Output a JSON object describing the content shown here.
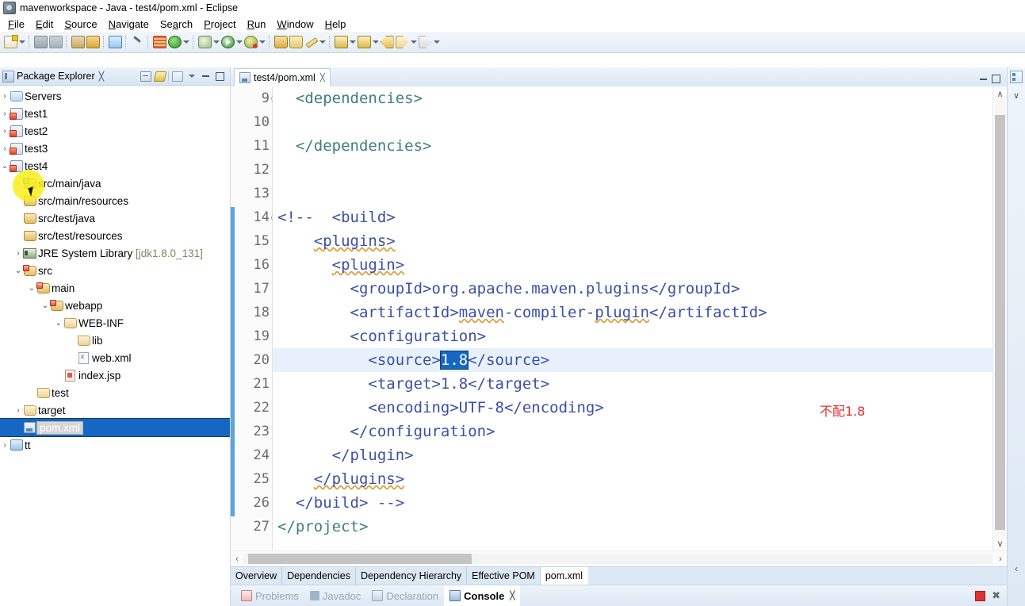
{
  "window": {
    "title": "mavenworkspace - Java - test4/pom.xml - Eclipse"
  },
  "menu": {
    "items": [
      "File",
      "Edit",
      "Source",
      "Navigate",
      "Search",
      "Project",
      "Run",
      "Window",
      "Help"
    ]
  },
  "toolbar": {
    "icons": [
      "new-wizard-icon",
      "save-icon",
      "save-all-icon",
      "print-icon",
      "undo-icon",
      "toggle-breadcrumb-icon",
      "pen-icon",
      "grid-icon",
      "refresh-icon",
      "external-tools-icon",
      "run-icon",
      "debug-icon",
      "open-type-icon",
      "open-resource-icon",
      "search-icon",
      "previous-annotation-icon",
      "next-annotation-icon",
      "back-icon",
      "forward-icon",
      "arrow-icon"
    ]
  },
  "package_explorer": {
    "title": "Package Explorer",
    "close_glyph": "╳",
    "tree": [
      {
        "label": "Servers",
        "indent": 0,
        "arrow": "›",
        "icon": "folder-servers-icon",
        "state": "collapsed"
      },
      {
        "label": "test1",
        "indent": 0,
        "arrow": "›",
        "icon": "maven-project-icon",
        "state": "collapsed"
      },
      {
        "label": "test2",
        "indent": 0,
        "arrow": "›",
        "icon": "maven-project-icon",
        "state": "collapsed"
      },
      {
        "label": "test3",
        "indent": 0,
        "arrow": "›",
        "icon": "maven-project-icon",
        "state": "collapsed"
      },
      {
        "label": "test4",
        "indent": 0,
        "arrow": "⌄",
        "icon": "maven-project-icon",
        "state": "expanded",
        "highlight": true
      },
      {
        "label": "src/main/java",
        "indent": 1,
        "arrow": "›",
        "icon": "source-folder-icon",
        "state": "collapsed"
      },
      {
        "label": "src/main/resources",
        "indent": 1,
        "arrow": "",
        "icon": "package-folder-icon",
        "state": "leaf"
      },
      {
        "label": "src/test/java",
        "indent": 1,
        "arrow": "",
        "icon": "package-folder-icon",
        "state": "leaf"
      },
      {
        "label": "src/test/resources",
        "indent": 1,
        "arrow": "",
        "icon": "package-folder-icon",
        "state": "leaf"
      },
      {
        "label": "JRE System Library",
        "suffix": "[jdk1.8.0_131]",
        "indent": 1,
        "arrow": "›",
        "icon": "jre-library-icon",
        "state": "collapsed"
      },
      {
        "label": "src",
        "indent": 1,
        "arrow": "⌄",
        "icon": "source-root-icon",
        "state": "expanded"
      },
      {
        "label": "main",
        "indent": 2,
        "arrow": "⌄",
        "icon": "source-root-icon",
        "state": "expanded"
      },
      {
        "label": "webapp",
        "indent": 3,
        "arrow": "⌄",
        "icon": "source-root-icon",
        "state": "expanded"
      },
      {
        "label": "WEB-INF",
        "indent": 4,
        "arrow": "⌄",
        "icon": "folder-icon",
        "state": "expanded"
      },
      {
        "label": "lib",
        "indent": 5,
        "arrow": "",
        "icon": "folder-icon",
        "state": "leaf"
      },
      {
        "label": "web.xml",
        "indent": 5,
        "arrow": "",
        "icon": "xml-file-icon",
        "state": "leaf"
      },
      {
        "label": "index.jsp",
        "indent": 4,
        "arrow": "",
        "icon": "jsp-file-icon",
        "state": "leaf"
      },
      {
        "label": "test",
        "indent": 2,
        "arrow": "",
        "icon": "folder-icon",
        "state": "leaf"
      },
      {
        "label": "target",
        "indent": 1,
        "arrow": "›",
        "icon": "folder-icon",
        "state": "collapsed"
      },
      {
        "label": "pom.xml",
        "indent": 1,
        "arrow": "",
        "icon": "pom-file-icon",
        "state": "leaf",
        "selected": true
      },
      {
        "label": "tt",
        "indent": 0,
        "arrow": "›",
        "icon": "project-icon",
        "state": "collapsed"
      }
    ]
  },
  "editor": {
    "tab_label": "test4/pom.xml",
    "tab_close_glyph": "╳",
    "first_line": 9,
    "current_line": 20,
    "change_bar_from": 14,
    "change_bar_to": 26,
    "annotation": {
      "text": "不配1.8",
      "color": "#e03030"
    },
    "lines": [
      {
        "n": 9,
        "fold": true,
        "segments": [
          {
            "t": "  ",
            "c": "plain"
          },
          {
            "t": "<dependencies>",
            "c": "tag"
          }
        ]
      },
      {
        "n": 10,
        "fold": false,
        "segments": []
      },
      {
        "n": 11,
        "fold": false,
        "segments": [
          {
            "t": "  ",
            "c": "plain"
          },
          {
            "t": "</dependencies>",
            "c": "tag"
          }
        ]
      },
      {
        "n": 12,
        "fold": false,
        "segments": []
      },
      {
        "n": 13,
        "fold": false,
        "segments": []
      },
      {
        "n": 14,
        "fold": true,
        "segments": [
          {
            "t": "<!--  <build>",
            "c": "cmt"
          }
        ]
      },
      {
        "n": 15,
        "fold": false,
        "segments": [
          {
            "t": "    ",
            "c": "cmt"
          },
          {
            "t": "<plugins>",
            "c": "cmt-sq"
          }
        ]
      },
      {
        "n": 16,
        "fold": false,
        "segments": [
          {
            "t": "      ",
            "c": "cmt"
          },
          {
            "t": "<plugin>",
            "c": "cmt-sq"
          }
        ]
      },
      {
        "n": 17,
        "fold": false,
        "segments": [
          {
            "t": "        <groupId>org.apache.maven.plugins</groupId>",
            "c": "cmt"
          }
        ]
      },
      {
        "n": 18,
        "fold": false,
        "segments": [
          {
            "t": "        <artifactId>",
            "c": "cmt"
          },
          {
            "t": "maven",
            "c": "cmt-sq"
          },
          {
            "t": "-compiler-",
            "c": "cmt"
          },
          {
            "t": "plugin",
            "c": "cmt-sq"
          },
          {
            "t": "</artifactId>",
            "c": "cmt"
          }
        ]
      },
      {
        "n": 19,
        "fold": false,
        "segments": [
          {
            "t": "        <configuration>",
            "c": "cmt"
          }
        ]
      },
      {
        "n": 20,
        "fold": false,
        "current": true,
        "segments": [
          {
            "t": "          <source>",
            "c": "cmt"
          },
          {
            "t": "1.8",
            "c": "sel"
          },
          {
            "t": "</source>",
            "c": "cmt"
          }
        ]
      },
      {
        "n": 21,
        "fold": false,
        "segments": [
          {
            "t": "          <target>1.8</target>",
            "c": "cmt"
          }
        ]
      },
      {
        "n": 22,
        "fold": false,
        "segments": [
          {
            "t": "          <encoding>UTF-8</encoding>",
            "c": "cmt"
          }
        ]
      },
      {
        "n": 23,
        "fold": false,
        "segments": [
          {
            "t": "        </configuration>",
            "c": "cmt"
          }
        ]
      },
      {
        "n": 24,
        "fold": false,
        "segments": [
          {
            "t": "      </plugin>",
            "c": "cmt"
          }
        ]
      },
      {
        "n": 25,
        "fold": false,
        "segments": [
          {
            "t": "    ",
            "c": "cmt"
          },
          {
            "t": "</plugins>",
            "c": "cmt-sq"
          }
        ]
      },
      {
        "n": 26,
        "fold": false,
        "segments": [
          {
            "t": "  </build> -->",
            "c": "cmt"
          }
        ]
      },
      {
        "n": 27,
        "fold": false,
        "segments": [
          {
            "t": "</project>",
            "c": "tag"
          }
        ]
      }
    ],
    "form_tabs": [
      {
        "label": "Overview",
        "active": false
      },
      {
        "label": "Dependencies",
        "active": false
      },
      {
        "label": "Dependency Hierarchy",
        "active": false
      },
      {
        "label": "Effective POM",
        "active": false
      },
      {
        "label": "pom.xml",
        "active": true
      }
    ],
    "scroll": {
      "v_up": "∧",
      "v_down": "∨",
      "h_left": "‹",
      "h_right": "›"
    }
  },
  "bottom_views": {
    "tabs": [
      {
        "label": "Problems",
        "icon": "problems-icon",
        "active": false
      },
      {
        "label": "Javadoc",
        "icon": "javadoc-icon",
        "active": false
      },
      {
        "label": "Declaration",
        "icon": "declaration-icon",
        "active": false
      },
      {
        "label": "Console",
        "icon": "console-icon",
        "active": true,
        "close_glyph": "╳"
      }
    ],
    "actions": [
      "stop-button",
      "close-console-button"
    ]
  },
  "right_dock": {
    "icons": [
      "outline-view-icon",
      "chevron-down-icon"
    ]
  },
  "colors": {
    "tag": "#3f7f7f",
    "comment": "#3b4fa8",
    "selection_bg": "#1667c4",
    "current_line_bg": "#e8f1fb",
    "change_bar": "#5ba4dd",
    "annotation_red": "#e03030",
    "highlight_yellow": "#f8ee1a"
  }
}
